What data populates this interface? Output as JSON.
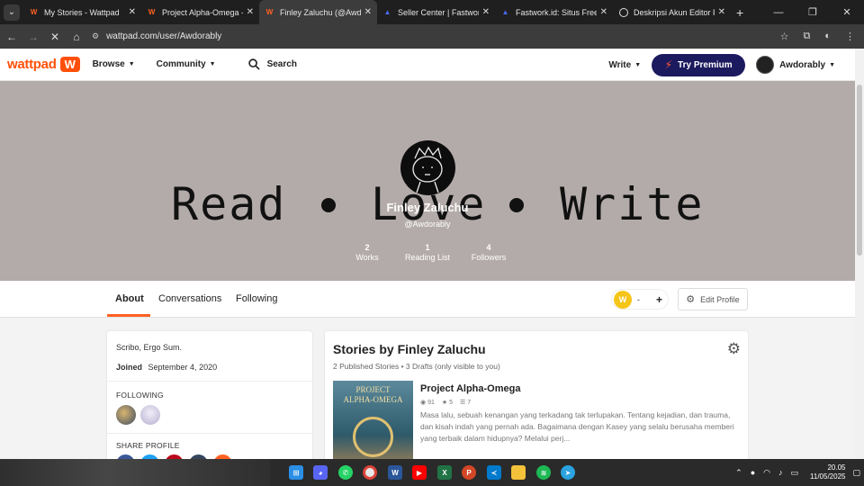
{
  "browser": {
    "tabs": [
      {
        "label": "My Stories - Wattpad",
        "icon": "wattpad-icon",
        "active": false
      },
      {
        "label": "Project Alpha-Omega - Fi",
        "icon": "wattpad-icon",
        "active": false
      },
      {
        "label": "Finley Zaluchu (@Awdorab",
        "icon": "wattpad-icon",
        "active": true
      },
      {
        "label": "Seller Center | Fastwork.id",
        "icon": "fastwork-icon",
        "active": false
      },
      {
        "label": "Fastwork.id: Situs Freelanc",
        "icon": "fastwork-icon",
        "active": false
      },
      {
        "label": "Deskripsi Akun Editor Pen",
        "icon": "globe-icon",
        "active": false
      }
    ],
    "tab_close": "✕",
    "new_tab": "+",
    "url": "wattpad.com/user/Awdorably"
  },
  "nav": {
    "logo": "wattpad",
    "logo_mark": "W",
    "browse": "Browse",
    "community": "Community",
    "search": "Search",
    "write": "Write",
    "premium": "Try Premium",
    "username": "Awdorably"
  },
  "banner": {
    "words": [
      "Read",
      "Love",
      "Write"
    ],
    "name": "Finley Zaluchu",
    "handle": "@Awdorably",
    "stats": [
      {
        "value": "2",
        "label": "Works"
      },
      {
        "value": "1",
        "label": "Reading List"
      },
      {
        "value": "4",
        "label": "Followers"
      }
    ]
  },
  "profile_tabs": {
    "items": [
      "About",
      "Conversations",
      "Following"
    ],
    "active": "About",
    "coins": "-",
    "coin_symbol": "W",
    "plus": "+",
    "edit_profile": "Edit Profile"
  },
  "about": {
    "description": "Scribo, Ergo Sum.",
    "joined_label": "Joined",
    "joined_date": "September 4, 2020",
    "following_heading": "FOLLOWING",
    "share_heading": "SHARE PROFILE"
  },
  "stories": {
    "title": "Stories by Finley Zaluchu",
    "subtitle": "2 Published Stories • 3 Drafts (only visible to you)",
    "items": [
      {
        "title": "Project Alpha-Omega",
        "cover_text": [
          "PROJECT",
          "ALPHA-OMEGA"
        ],
        "reads": "91",
        "votes": "5",
        "parts": "7",
        "description": "Masa lalu, sebuah kenangan yang terkadang tak terlupakan. Tentang kejadian, dan trauma, dan kisah indah yang pernah ada. Bagaimana dengan Kasey yang selalu berusaha memberi yang terbaik dalam hidupnya? Melalui perj..."
      }
    ]
  },
  "taskbar": {
    "time": "20.05",
    "date": "11/05/2025"
  },
  "colors": {
    "brand": "#ff500a",
    "premium": "#1c1a5e",
    "banner": "#b3aba9"
  }
}
